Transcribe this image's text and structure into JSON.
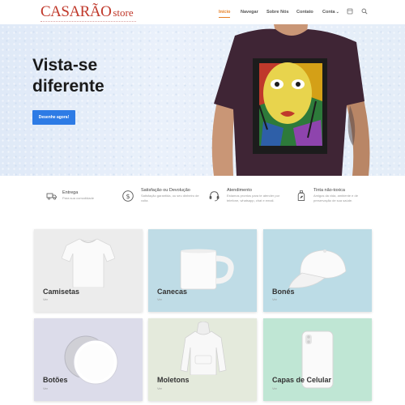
{
  "header": {
    "logo_main": "CASARÃO",
    "logo_store": "store",
    "nav": {
      "home": "Início",
      "navegar": "Navegar",
      "sobre": "Sobre Nós",
      "contato": "Contato",
      "conta": "Conta"
    }
  },
  "hero": {
    "title": "Vista-se diferente",
    "button": "Desenhe agora!"
  },
  "features": [
    {
      "title": "Entrega",
      "text": "Para sua comodidade",
      "icon": "truck-icon"
    },
    {
      "title": "Satisfação ou Devolução",
      "text": "Satisfação garantida, ou seu dinheiro de volta",
      "icon": "money-back-icon"
    },
    {
      "title": "Atendimento",
      "text": "Estamos prontos para te atender por telefone, whatsapp, chat e email.",
      "icon": "headset-icon"
    },
    {
      "title": "Tinta não-toxica",
      "text": "Amigos da vida, ambiente e de preservação de sua saúde.",
      "icon": "eco-bottle-icon"
    }
  ],
  "categories": [
    {
      "title": "Camisetas",
      "sub": "Ver",
      "bg": "#ececec"
    },
    {
      "title": "Canecas",
      "sub": "Ver",
      "bg": "#bfdce6"
    },
    {
      "title": "Bonés",
      "sub": "Ver",
      "bg": "#bcdce6"
    },
    {
      "title": "Botões",
      "sub": "Ver",
      "bg": "#dcdcea"
    },
    {
      "title": "Moletons",
      "sub": "Ver",
      "bg": "#e4eadc"
    },
    {
      "title": "Capas de Celular",
      "sub": "Ver",
      "bg": "#bfe6d4"
    }
  ],
  "colors": {
    "accent": "#e67e22",
    "button": "#2d7be5",
    "logo": "#c0392b"
  }
}
